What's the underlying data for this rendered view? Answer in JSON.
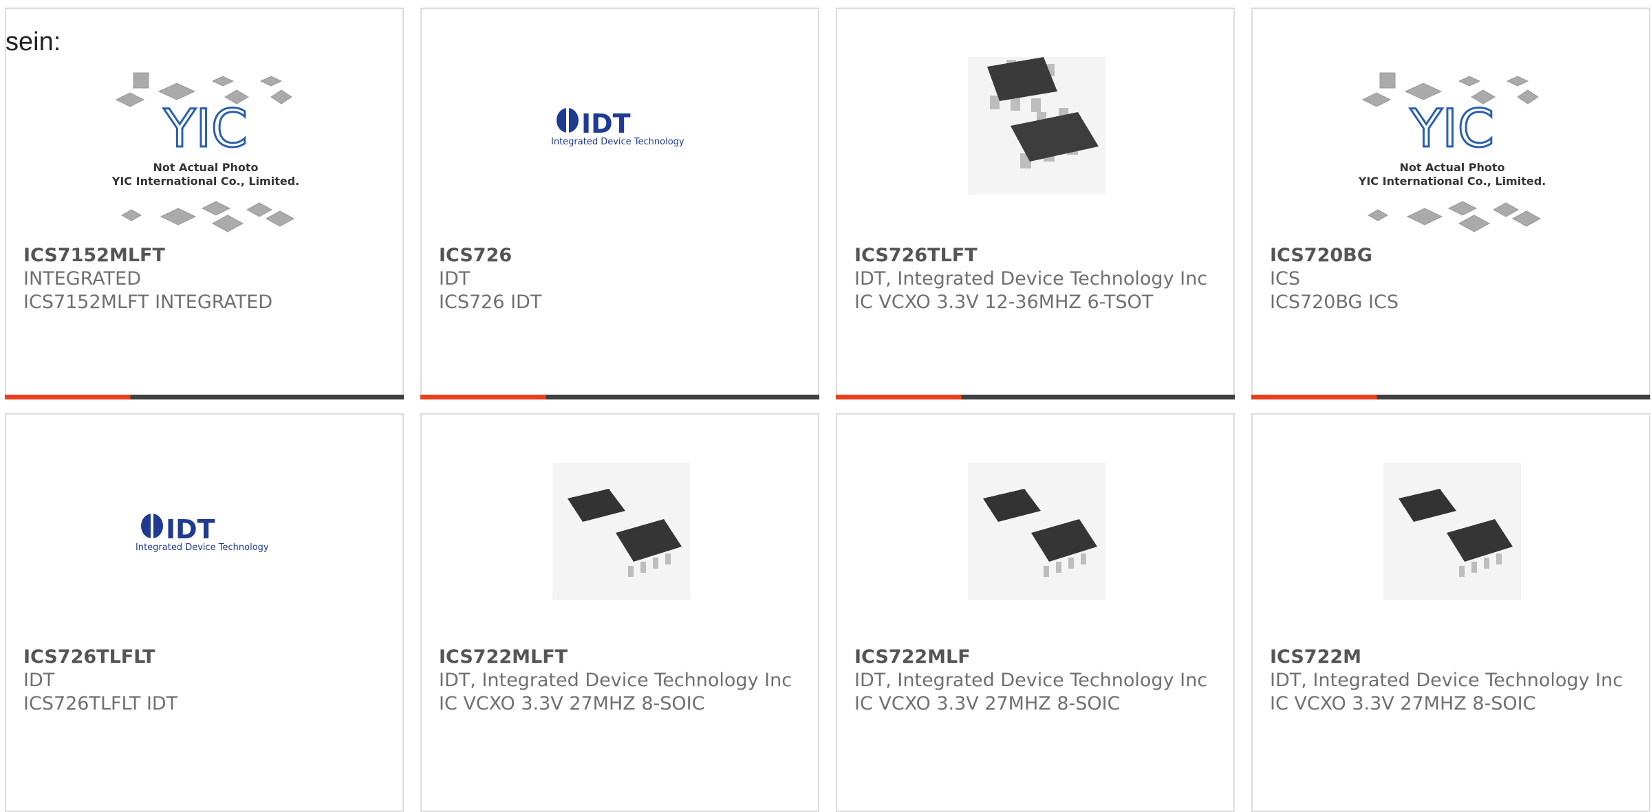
{
  "intro_text": "sein:",
  "accent_color": "#e8401c",
  "bar_color": "#3f3f3f",
  "yic_placeholder": {
    "line1": "Not Actual Photo",
    "line2": "YIC International Co., Limited."
  },
  "idt_logo": {
    "brand": "IDT",
    "tagline": "Integrated Device Technology"
  },
  "products": [
    {
      "part": "ICS7152MLFT",
      "manufacturer": "INTEGRATED",
      "description": "ICS7152MLFT INTEGRATED",
      "image": "yic-placeholder"
    },
    {
      "part": "ICS726",
      "manufacturer": "IDT",
      "description": "ICS726 IDT",
      "image": "idt-logo"
    },
    {
      "part": "ICS726TLFT",
      "manufacturer": "IDT, Integrated Device Technology Inc",
      "description": "IC VCXO 3.3V 12-36MHZ 6-TSOT",
      "image": "chip-6tsot"
    },
    {
      "part": "ICS720BG",
      "manufacturer": "ICS",
      "description": "ICS720BG ICS",
      "image": "yic-placeholder"
    },
    {
      "part": "ICS726TLFLT",
      "manufacturer": "IDT",
      "description": "ICS726TLFLT IDT",
      "image": "idt-logo"
    },
    {
      "part": "ICS722MLFT",
      "manufacturer": "IDT, Integrated Device Technology Inc",
      "description": "IC VCXO 3.3V 27MHZ 8-SOIC",
      "image": "chip-8soic"
    },
    {
      "part": "ICS722MLF",
      "manufacturer": "IDT, Integrated Device Technology Inc",
      "description": "IC VCXO 3.3V 27MHZ 8-SOIC",
      "image": "chip-8soic"
    },
    {
      "part": "ICS722M",
      "manufacturer": "IDT, Integrated Device Technology Inc",
      "description": "IC VCXO 3.3V 27MHZ 8-SOIC",
      "image": "chip-8soic"
    }
  ]
}
